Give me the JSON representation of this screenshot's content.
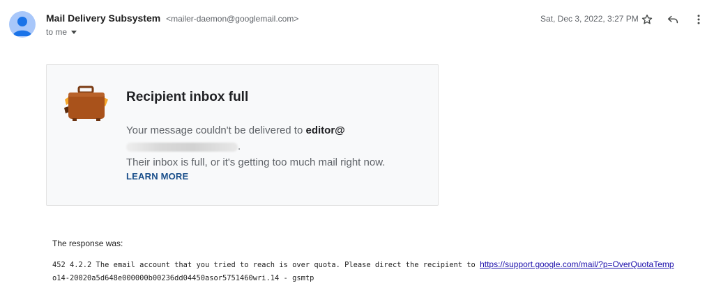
{
  "header": {
    "sender_name": "Mail Delivery Subsystem",
    "sender_email": "<mailer-daemon@googlemail.com>",
    "to_line": "to me",
    "timestamp": "Sat, Dec 3, 2022, 3:27 PM",
    "icons": [
      "avatar",
      "star-icon",
      "reply-icon",
      "more-vertical-icon",
      "chevron-down-icon"
    ]
  },
  "card": {
    "icon": "briefcase-icon",
    "title": "Recipient inbox full",
    "body_prefix": "Your message couldn't be delivered to",
    "recipient_visible": "editor@",
    "body_suffix": ".",
    "body_line2": "Their inbox is full, or it's getting too much mail right now.",
    "learn_more": "LEARN MORE"
  },
  "response": {
    "label": "The response was:",
    "line1_text": "452 4.2.2 The email account that you tried to reach is over quota. Please direct the recipient to",
    "link": "https://support.google.com/mail/?p=OverQuotaTemp",
    "line2_text": "o14-20020a5d648e000000b00236dd04450asor5751460wri.14 - gsmtp"
  },
  "colors": {
    "avatar_bg": "#a8c7fa",
    "avatar_fg": "#1a73e8",
    "card_bg": "#f8f9fa",
    "learn_more": "#1a4f8b",
    "briefcase": "#a9521b",
    "briefcase_accent": "#f4a62a"
  }
}
